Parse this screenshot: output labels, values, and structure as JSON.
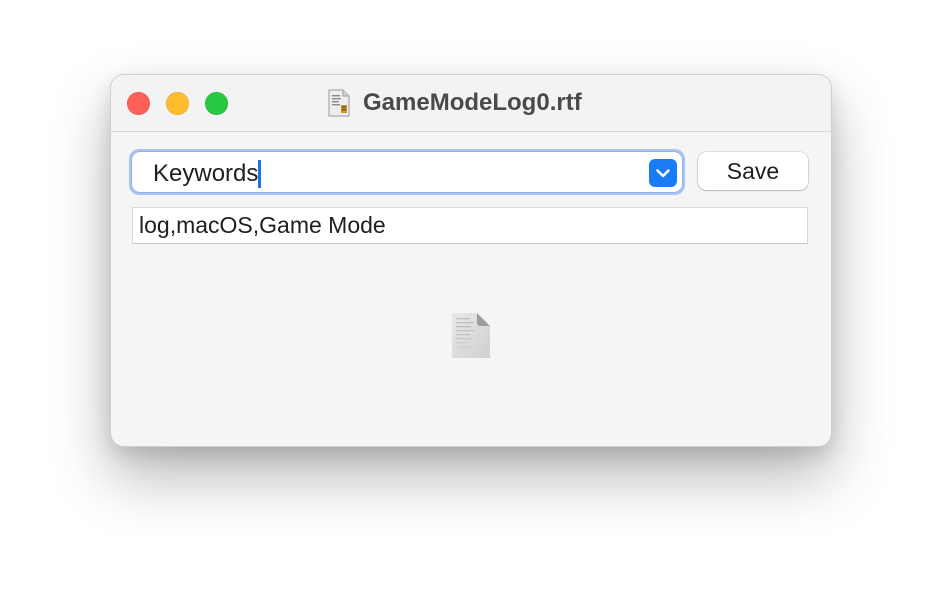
{
  "window": {
    "title": "GameModeLog0.rtf",
    "title_icon": "rtf-document-icon"
  },
  "traffic_lights": {
    "close": "#fe5f57",
    "minimize": "#febc2e",
    "zoom": "#28c840"
  },
  "metadata_selector": {
    "value": "Keywords",
    "icon": "chevron-down-icon",
    "accent_color": "#1a7cf5"
  },
  "save_button": {
    "label": "Save"
  },
  "keywords_field": {
    "value": "log,macOS,Game Mode"
  },
  "preview": {
    "icon": "document-preview-icon"
  }
}
